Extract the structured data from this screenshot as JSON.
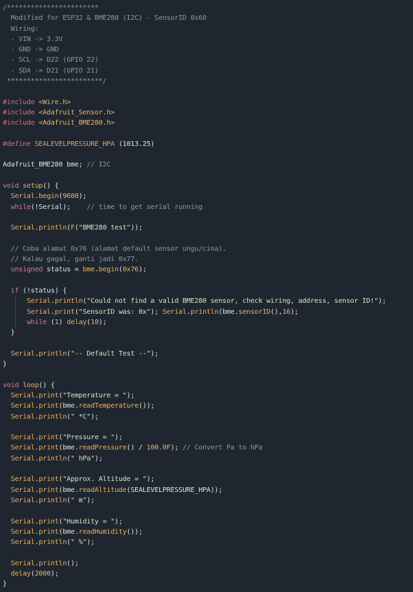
{
  "editor": {
    "language": "cpp",
    "colors": {
      "background": "#1f262f",
      "text": "#dfe5ea",
      "comment": "#8e98a3",
      "preprocessor": "#e06c75",
      "keyword": "#d77aa6",
      "function": "#f0b057",
      "string": "#d8e4c3",
      "number": "#e6b673",
      "macro": "#f0a04b",
      "indent_guide": "#3c4653"
    },
    "lines": [
      [
        [
          "comment",
          "/***********************"
        ]
      ],
      [
        [
          "comment",
          "  Modified for ESP32 & BME280 (I2C) - SensorID 0x60"
        ]
      ],
      [
        [
          "comment",
          "  Wiring:"
        ]
      ],
      [
        [
          "comment",
          "  - VIN -> 3.3V"
        ]
      ],
      [
        [
          "comment",
          "  - GND -> GND"
        ]
      ],
      [
        [
          "comment",
          "  - SCL -> D22 (GPIO 22)"
        ]
      ],
      [
        [
          "comment",
          "  - SDA -> D21 (GPIO 21)"
        ]
      ],
      [
        [
          "comment",
          " ************************/"
        ]
      ],
      [],
      [
        [
          "pre",
          "#include "
        ],
        [
          "header",
          "<Wire.h>"
        ]
      ],
      [
        [
          "pre",
          "#include "
        ],
        [
          "header",
          "<Adafruit_Sensor.h>"
        ]
      ],
      [
        [
          "pre",
          "#include "
        ],
        [
          "header",
          "<Adafruit_BME280.h>"
        ]
      ],
      [],
      [
        [
          "pre",
          "#define "
        ],
        [
          "macro",
          "SEALEVELPRESSURE_HPA"
        ],
        [
          "plain",
          " (1013.25)"
        ]
      ],
      [],
      [
        [
          "plain",
          "Adafruit_BME280 bme; "
        ],
        [
          "comment",
          "// I2C"
        ]
      ],
      [],
      [
        [
          "keyword",
          "void "
        ],
        [
          "func",
          "setup"
        ],
        [
          "plain",
          "() {"
        ]
      ],
      [
        [
          "plain",
          "  "
        ],
        [
          "obj",
          "Serial"
        ],
        [
          "plain",
          "."
        ],
        [
          "method",
          "begin"
        ],
        [
          "plain",
          "("
        ],
        [
          "number",
          "9600"
        ],
        [
          "plain",
          ");"
        ]
      ],
      [
        [
          "plain",
          "  "
        ],
        [
          "keyword",
          "while"
        ],
        [
          "plain",
          "(!Serial);    "
        ],
        [
          "comment",
          "// time to get serial running"
        ]
      ],
      [],
      [
        [
          "plain",
          "  "
        ],
        [
          "obj",
          "Serial"
        ],
        [
          "plain",
          "."
        ],
        [
          "method",
          "println"
        ],
        [
          "plain",
          "("
        ],
        [
          "func",
          "F"
        ],
        [
          "plain",
          "("
        ],
        [
          "string",
          "\"BME280 test\""
        ],
        [
          "plain",
          "));"
        ]
      ],
      [],
      [
        [
          "plain",
          "  "
        ],
        [
          "comment",
          "// Coba alamat 0x76 (alamat default sensor ungu/cina)."
        ]
      ],
      [
        [
          "plain",
          "  "
        ],
        [
          "comment",
          "// Kalau gagal, ganti jadi 0x77."
        ]
      ],
      [
        [
          "plain",
          "  "
        ],
        [
          "keyword",
          "unsigned"
        ],
        [
          "plain",
          " status = "
        ],
        [
          "obj",
          "bme"
        ],
        [
          "plain",
          "."
        ],
        [
          "method",
          "begin"
        ],
        [
          "plain",
          "("
        ],
        [
          "number",
          "0x76"
        ],
        [
          "plain",
          ");"
        ]
      ],
      [],
      [
        [
          "plain",
          "  "
        ],
        [
          "keyword",
          "if"
        ],
        [
          "plain",
          " (!status) {"
        ]
      ],
      [
        [
          "plain",
          "      "
        ],
        [
          "obj",
          "Serial"
        ],
        [
          "plain",
          "."
        ],
        [
          "method",
          "println"
        ],
        [
          "plain",
          "("
        ],
        [
          "string",
          "\"Could not find a valid BME280 sensor, check wiring, address, sensor ID!\""
        ],
        [
          "plain",
          ");"
        ]
      ],
      [
        [
          "plain",
          "      "
        ],
        [
          "obj",
          "Serial"
        ],
        [
          "plain",
          "."
        ],
        [
          "method",
          "print"
        ],
        [
          "plain",
          "("
        ],
        [
          "string",
          "\"SensorID was: 0x\""
        ],
        [
          "plain",
          "); "
        ],
        [
          "obj",
          "Serial"
        ],
        [
          "plain",
          "."
        ],
        [
          "method",
          "println"
        ],
        [
          "plain",
          "(bme."
        ],
        [
          "method",
          "sensorID"
        ],
        [
          "plain",
          "(),"
        ],
        [
          "number",
          "16"
        ],
        [
          "plain",
          ");"
        ]
      ],
      [
        [
          "plain",
          "      "
        ],
        [
          "keyword",
          "while"
        ],
        [
          "plain",
          " ("
        ],
        [
          "number",
          "1"
        ],
        [
          "plain",
          ") "
        ],
        [
          "func",
          "delay"
        ],
        [
          "plain",
          "("
        ],
        [
          "number",
          "10"
        ],
        [
          "plain",
          ");"
        ]
      ],
      [
        [
          "plain",
          "  }"
        ]
      ],
      [],
      [
        [
          "plain",
          "  "
        ],
        [
          "obj",
          "Serial"
        ],
        [
          "plain",
          "."
        ],
        [
          "method",
          "println"
        ],
        [
          "plain",
          "("
        ],
        [
          "string",
          "\"-- Default Test --\""
        ],
        [
          "plain",
          ");"
        ]
      ],
      [
        [
          "plain",
          "}"
        ]
      ],
      [],
      [
        [
          "keyword",
          "void "
        ],
        [
          "func",
          "loop"
        ],
        [
          "plain",
          "() {"
        ]
      ],
      [
        [
          "plain",
          "  "
        ],
        [
          "obj",
          "Serial"
        ],
        [
          "plain",
          "."
        ],
        [
          "method",
          "print"
        ],
        [
          "plain",
          "("
        ],
        [
          "string",
          "\"Temperature = \""
        ],
        [
          "plain",
          ");"
        ]
      ],
      [
        [
          "plain",
          "  "
        ],
        [
          "obj",
          "Serial"
        ],
        [
          "plain",
          "."
        ],
        [
          "method",
          "print"
        ],
        [
          "plain",
          "(bme."
        ],
        [
          "method",
          "readTemperature"
        ],
        [
          "plain",
          "());"
        ]
      ],
      [
        [
          "plain",
          "  "
        ],
        [
          "obj",
          "Serial"
        ],
        [
          "plain",
          "."
        ],
        [
          "method",
          "println"
        ],
        [
          "plain",
          "("
        ],
        [
          "string",
          "\" *C\""
        ],
        [
          "plain",
          ");"
        ]
      ],
      [],
      [
        [
          "plain",
          "  "
        ],
        [
          "obj",
          "Serial"
        ],
        [
          "plain",
          "."
        ],
        [
          "method",
          "print"
        ],
        [
          "plain",
          "("
        ],
        [
          "string",
          "\"Pressure = \""
        ],
        [
          "plain",
          ");"
        ]
      ],
      [
        [
          "plain",
          "  "
        ],
        [
          "obj",
          "Serial"
        ],
        [
          "plain",
          "."
        ],
        [
          "method",
          "print"
        ],
        [
          "plain",
          "(bme."
        ],
        [
          "method",
          "readPressure"
        ],
        [
          "plain",
          "() / "
        ],
        [
          "number",
          "100.0F"
        ],
        [
          "plain",
          "); "
        ],
        [
          "comment",
          "// Convert Pa to hPa"
        ]
      ],
      [
        [
          "plain",
          "  "
        ],
        [
          "obj",
          "Serial"
        ],
        [
          "plain",
          "."
        ],
        [
          "method",
          "println"
        ],
        [
          "plain",
          "("
        ],
        [
          "string",
          "\" hPa\""
        ],
        [
          "plain",
          ");"
        ]
      ],
      [],
      [
        [
          "plain",
          "  "
        ],
        [
          "obj",
          "Serial"
        ],
        [
          "plain",
          "."
        ],
        [
          "method",
          "print"
        ],
        [
          "plain",
          "("
        ],
        [
          "string",
          "\"Approx. Altitude = \""
        ],
        [
          "plain",
          ");"
        ]
      ],
      [
        [
          "plain",
          "  "
        ],
        [
          "obj",
          "Serial"
        ],
        [
          "plain",
          "."
        ],
        [
          "method",
          "print"
        ],
        [
          "plain",
          "(bme."
        ],
        [
          "method",
          "readAltitude"
        ],
        [
          "plain",
          "(SEALEVELPRESSURE_HPA));"
        ]
      ],
      [
        [
          "plain",
          "  "
        ],
        [
          "obj",
          "Serial"
        ],
        [
          "plain",
          "."
        ],
        [
          "method",
          "println"
        ],
        [
          "plain",
          "("
        ],
        [
          "string",
          "\" m\""
        ],
        [
          "plain",
          ");"
        ]
      ],
      [],
      [
        [
          "plain",
          "  "
        ],
        [
          "obj",
          "Serial"
        ],
        [
          "plain",
          "."
        ],
        [
          "method",
          "print"
        ],
        [
          "plain",
          "("
        ],
        [
          "string",
          "\"Humidity = \""
        ],
        [
          "plain",
          ");"
        ]
      ],
      [
        [
          "plain",
          "  "
        ],
        [
          "obj",
          "Serial"
        ],
        [
          "plain",
          "."
        ],
        [
          "method",
          "print"
        ],
        [
          "plain",
          "(bme."
        ],
        [
          "method",
          "readHumidity"
        ],
        [
          "plain",
          "());"
        ]
      ],
      [
        [
          "plain",
          "  "
        ],
        [
          "obj",
          "Serial"
        ],
        [
          "plain",
          "."
        ],
        [
          "method",
          "println"
        ],
        [
          "plain",
          "("
        ],
        [
          "string",
          "\" %\""
        ],
        [
          "plain",
          ");"
        ]
      ],
      [],
      [
        [
          "plain",
          "  "
        ],
        [
          "obj",
          "Serial"
        ],
        [
          "plain",
          "."
        ],
        [
          "method",
          "println"
        ],
        [
          "plain",
          "();"
        ]
      ],
      [
        [
          "plain",
          "  "
        ],
        [
          "func",
          "delay"
        ],
        [
          "plain",
          "("
        ],
        [
          "number",
          "2000"
        ],
        [
          "plain",
          ");"
        ]
      ],
      [
        [
          "plain",
          "}"
        ]
      ]
    ]
  }
}
